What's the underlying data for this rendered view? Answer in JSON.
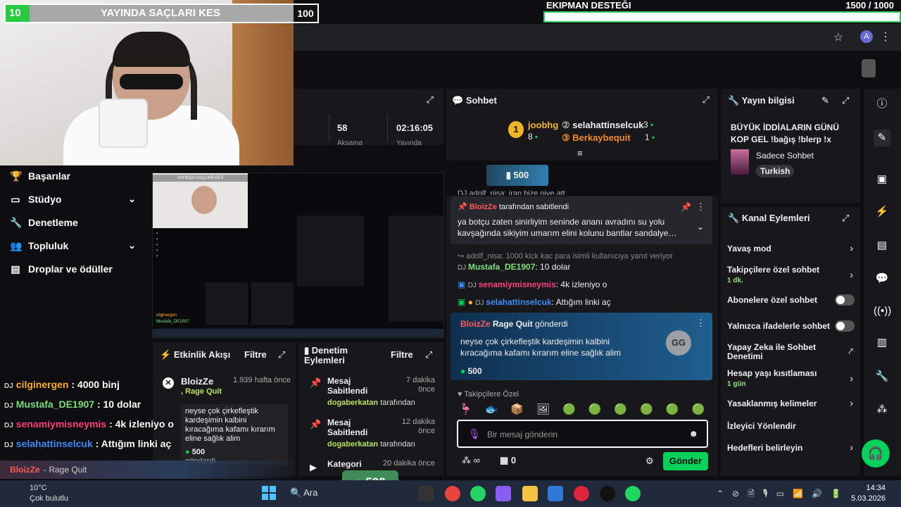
{
  "overlay": {
    "level": "10",
    "challenge_title": "YAYINDA SAÇLARI KES",
    "challenge_value": "100",
    "equipment_title": "EKIPMAN DESTEĞI",
    "equipment_value": "1500  / 1000",
    "equipment_progress": 1.0,
    "chat": [
      {
        "badge": "DJ",
        "user": "cilginergen",
        "text": " : 4000 binj",
        "color": "#ffb020"
      },
      {
        "badge": "DJ",
        "user": "Mustafa_DE1907",
        "text": " : 10 dolar",
        "color": "#7be07b"
      },
      {
        "badge": "DJ",
        "user": "senamiymisneymis",
        "text": " : 4k izleniyo o",
        "color": "#ff3f7f"
      },
      {
        "badge": "DJ",
        "user": "selahattinselcuk",
        "text": " : Attığım linki aç",
        "color": "#3a8eff"
      }
    ],
    "ragequit_user": "BloizZe",
    "ragequit_text": " - Rage Quit",
    "ragequit_amount": "500"
  },
  "left_nav": {
    "items": [
      {
        "label": "Başarılar",
        "icon": "trophy-icon"
      },
      {
        "label": "Stüdyo",
        "icon": "studio-icon"
      },
      {
        "label": "Denetleme",
        "icon": "wrench-icon"
      },
      {
        "label": "Topluluk",
        "icon": "people-icon"
      },
      {
        "label": "Droplar ve ödüller",
        "icon": "gift-icon"
      }
    ]
  },
  "stats": {
    "viewers": "58",
    "uptime": "02:16:05",
    "label_a": "Aksama",
    "label_b": "Yayında"
  },
  "activity": {
    "title": "Etkinlik Akışı",
    "filter": "Filtre",
    "item_user": "BloizZe",
    "item_time": "1.939 hafta önce",
    "item_type": "Rage Quit",
    "item_msg": "neyse çok çirkefleştik kardeşimin kalbini kıracağıma kafamı kırarım eline sağlık alim",
    "item_amount": "500",
    "item_sent": "gönderdi"
  },
  "mod_actions": {
    "title": "Denetim Eylemleri",
    "filter": "Filtre",
    "items": [
      {
        "title": "Mesaj Sabitlendi",
        "time": "7 dakika önce",
        "by": "dogaberkatan",
        "suffix": " tarafından"
      },
      {
        "title": "Mesaj Sabitlendi",
        "time": "12 dakika önce",
        "by": "dogaberkatan",
        "suffix": " tarafından"
      },
      {
        "title": "Kategori",
        "time": "20 dakika önce",
        "by": "",
        "suffix": ""
      }
    ]
  },
  "chat": {
    "title": "Sohbet",
    "leaderboard": {
      "first": "joobhg",
      "first_count": "8",
      "second": "selahattinselcuk",
      "second_count": "3",
      "third": "Berkaybequit",
      "third_count": "1"
    },
    "points_pill": "500",
    "scroll_line": "DJ adolf_nisa: iran bize niye att",
    "pinned_by_user": "BloizZe",
    "pinned_by_text": " tarafından sabitlendi",
    "pinned_text": "ya botçu zaten sinirliyim seninde ananı avradını su yolu kavşağında sikiyim umarım elini kolunu bantlar sandalye…",
    "reply_line": "↪ adolf_nisa: 1000 kick kac para isimli kullanıcıya yanıt veriyor",
    "messages": [
      {
        "user": "Mustafa_DE1907",
        "text": ": 10 dolar",
        "color": "#7be07b"
      },
      {
        "user": "senamiymisneymis",
        "text": ": 4k izleniyo o",
        "color": "#ff3f7f"
      },
      {
        "user": "selahattinselcuk",
        "text": ": Attığım linki aç",
        "color": "#3a8eff"
      }
    ],
    "hype_user": "BloizZe",
    "hype_item": "Rage Quit",
    "hype_sent": " gönderdi",
    "hype_text": "neyse çok çirkefleştik kardeşimin kalbini kıracağıma kafamı kırarım eline sağlık alim",
    "hype_amount": "500",
    "followers_only": "Takipçilere Özel",
    "input_placeholder": "Bir mesaj gönderin",
    "points_count": "0",
    "send": "Gönder"
  },
  "stream_info": {
    "title": "Yayın bilgisi",
    "stream_title": "BÜYÜK İDDİALARIN GÜNÜ KOP GEL !bağış !blerp !x",
    "category": "Sadece Sohbet",
    "tag": "Turkish"
  },
  "channel_actions": {
    "title": "Kanal Eylemleri",
    "items": [
      {
        "label": "Yavaş mod",
        "sub": "",
        "control": "chevron"
      },
      {
        "label": "Takipçilere özel sohbet",
        "sub": "1 dk.",
        "control": "chevron"
      },
      {
        "label": "Abonelere özel sohbet",
        "sub": "",
        "control": "toggle"
      },
      {
        "label": "Yalnızca ifadelerle sohbet",
        "sub": "",
        "control": "toggle"
      },
      {
        "label": "Yapay Zeka ile Sohbet Denetimi",
        "sub": "",
        "control": "external"
      },
      {
        "label": "Hesap yaşı kısıtlaması",
        "sub": "1 gün",
        "control": "chevron"
      },
      {
        "label": "Yasaklanmış kelimeler",
        "sub": "",
        "control": "chevron"
      },
      {
        "label": "İzleyici Yönlendir",
        "sub": "",
        "control": "none"
      },
      {
        "label": "Hedefleri belirleyin",
        "sub": "",
        "control": "chevron"
      }
    ]
  },
  "taskbar": {
    "temp": "10°C",
    "weather": "Çok bulutlu",
    "search": "Ara",
    "time": "14:34",
    "date": "5.03.2026"
  },
  "colors": {
    "accent": "#00d25b",
    "panel": "#18181b",
    "bg": "#0e0e10"
  }
}
